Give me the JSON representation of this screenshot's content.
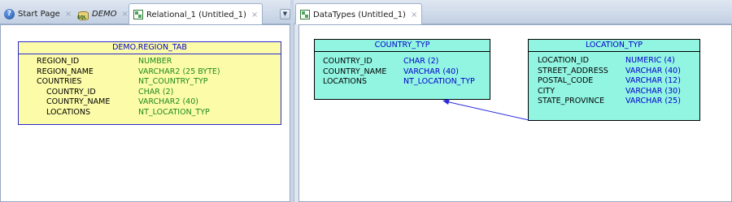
{
  "left_tabs": [
    {
      "label": "Start Page",
      "icon": "help-icon",
      "active": false
    },
    {
      "label": "DEMO",
      "icon": "connection-icon",
      "active": false
    },
    {
      "label": "Relational_1 (Untitled_1)",
      "icon": "relational-model-icon",
      "active": true
    }
  ],
  "right_tabs": [
    {
      "label": "DataTypes (Untitled_1)",
      "icon": "datatypes-model-icon",
      "active": true
    }
  ],
  "close_glyph": "×",
  "connection_icon_text": "SQL",
  "relational_model": {
    "table": {
      "title": "DEMO.REGION_TAB",
      "columns": [
        {
          "name": "REGION_ID",
          "type": "NUMBER",
          "indent": 0
        },
        {
          "name": "REGION_NAME",
          "type": "VARCHAR2 (25 BYTE)",
          "indent": 0
        },
        {
          "name": "COUNTRIES",
          "type": "NT_COUNTRY_TYP",
          "indent": 0
        },
        {
          "name": "COUNTRY_ID",
          "type": "CHAR (2)",
          "indent": 1
        },
        {
          "name": "COUNTRY_NAME",
          "type": "VARCHAR2 (40)",
          "indent": 1
        },
        {
          "name": "LOCATIONS",
          "type": "NT_LOCATION_TYP",
          "indent": 1
        }
      ],
      "colors": {
        "fill": "#fcfca8",
        "border": "#2a2ad0",
        "type_text": "#1e8a1e"
      }
    }
  },
  "datatypes_model": {
    "country_typ": {
      "title": "COUNTRY_TYP",
      "attributes": [
        {
          "name": "COUNTRY_ID",
          "type": "CHAR (2)"
        },
        {
          "name": "COUNTRY_NAME",
          "type": "VARCHAR (40)"
        },
        {
          "name": "LOCATIONS",
          "type": "NT_LOCATION_TYP"
        }
      ]
    },
    "location_typ": {
      "title": "LOCATION_TYP",
      "attributes": [
        {
          "name": "LOCATION_ID",
          "type": "NUMERIC (4)"
        },
        {
          "name": "STREET_ADDRESS",
          "type": "VARCHAR (40)"
        },
        {
          "name": "POSTAL_CODE",
          "type": "VARCHAR (12)"
        },
        {
          "name": "CITY",
          "type": "VARCHAR (30)"
        },
        {
          "name": "STATE_PROVINCE",
          "type": "VARCHAR (25)"
        }
      ]
    },
    "colors": {
      "fill": "#92f5e2",
      "type_text": "#0000cc",
      "connector": "#2a2ae0"
    }
  }
}
